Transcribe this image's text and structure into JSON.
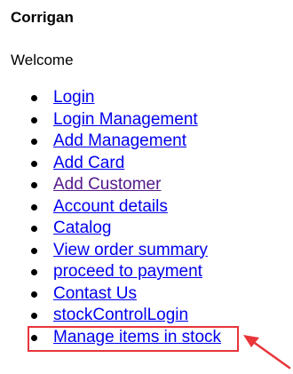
{
  "header": {
    "site_title": "Corrigan",
    "welcome": "Welcome"
  },
  "nav": {
    "items": [
      {
        "label": "Login",
        "visited": false
      },
      {
        "label": "Login Management",
        "visited": false
      },
      {
        "label": "Add Management",
        "visited": false
      },
      {
        "label": "Add Card",
        "visited": false
      },
      {
        "label": "Add Customer",
        "visited": true
      },
      {
        "label": "Account details",
        "visited": false
      },
      {
        "label": "Catalog",
        "visited": false
      },
      {
        "label": "View order summary",
        "visited": false
      },
      {
        "label": "proceed to payment",
        "visited": false
      },
      {
        "label": "Contast Us",
        "visited": false
      },
      {
        "label": "stockControlLogin",
        "visited": false
      },
      {
        "label": "Manage items in stock",
        "visited": false
      }
    ]
  },
  "colors": {
    "link": "#0000ee",
    "visited_link": "#551a8b",
    "annotation": "#e8353a"
  }
}
